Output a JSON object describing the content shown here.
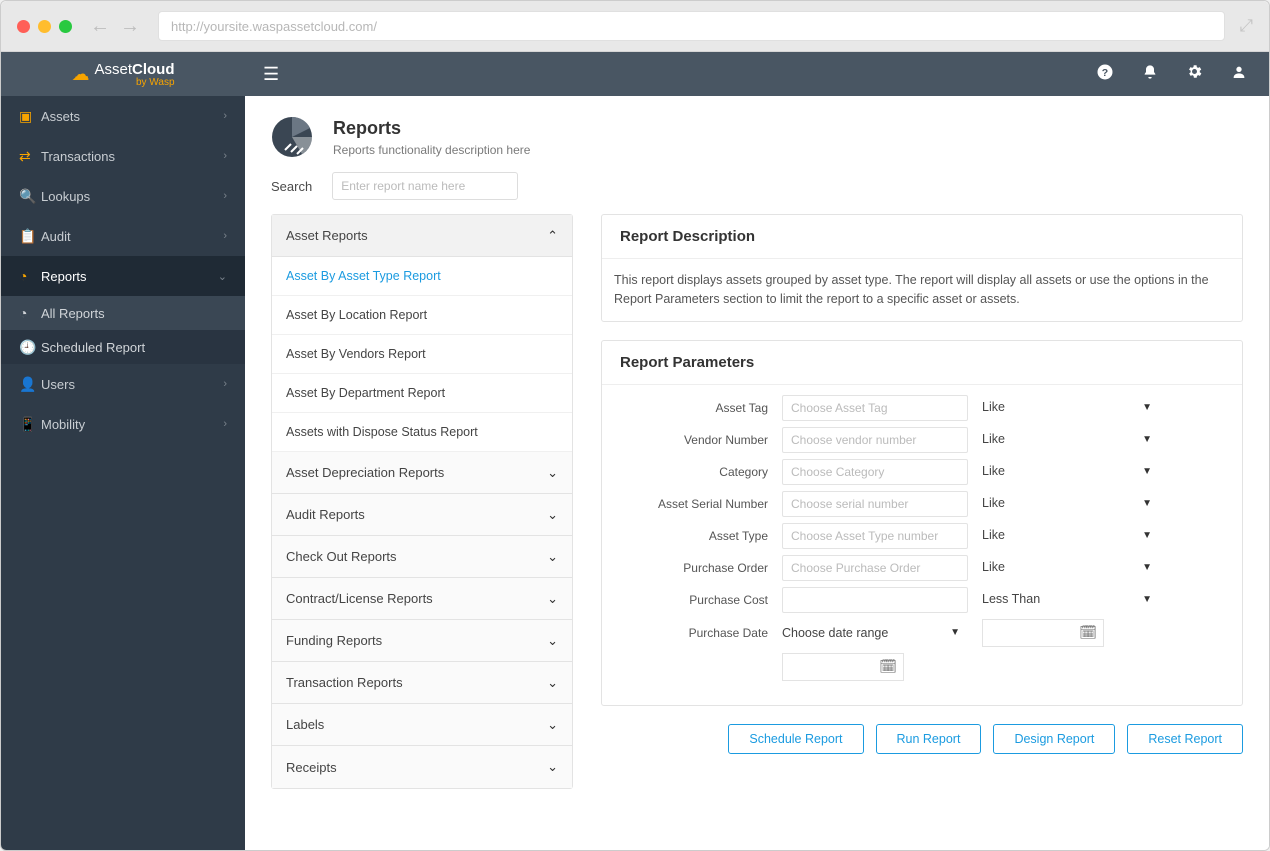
{
  "browser": {
    "url": "http://yoursite.waspassetcloud.com/"
  },
  "brand": {
    "name": "AssetCloud",
    "by": "by Wasp"
  },
  "sidebar": {
    "items": [
      {
        "label": "Assets",
        "icon": "box-icon"
      },
      {
        "label": "Transactions",
        "icon": "transactions-icon"
      },
      {
        "label": "Lookups",
        "icon": "search-icon"
      },
      {
        "label": "Audit",
        "icon": "clipboard-icon"
      },
      {
        "label": "Reports",
        "icon": "pie-icon",
        "active": true
      },
      {
        "label": "Users",
        "icon": "user-icon"
      },
      {
        "label": "Mobility",
        "icon": "tablet-icon"
      }
    ],
    "reports_sub": [
      {
        "label": "All Reports"
      },
      {
        "label": "Scheduled Report"
      }
    ]
  },
  "page": {
    "title": "Reports",
    "subtitle": "Reports functionality description here",
    "search_label": "Search",
    "search_placeholder": "Enter report name here"
  },
  "accordion": {
    "open": {
      "title": "Asset Reports",
      "items": [
        "Asset By Asset Type Report",
        "Asset By Location Report",
        "Asset By Vendors Report",
        "Asset By Department Report",
        "Assets with Dispose Status Report"
      ]
    },
    "closed": [
      "Asset Depreciation Reports",
      "Audit Reports",
      "Check Out Reports",
      "Contract/License Reports",
      "Funding Reports",
      "Transaction Reports",
      "Labels",
      "Receipts"
    ]
  },
  "description": {
    "title": "Report Description",
    "text": "This report displays assets grouped by asset type. The report will display all assets or use the options in the Report Parameters section to limit the report to a specific asset or assets."
  },
  "parameters": {
    "title": "Report Parameters",
    "rows": [
      {
        "label": "Asset Tag",
        "placeholder": "Choose Asset Tag",
        "op": "Like"
      },
      {
        "label": "Vendor Number",
        "placeholder": "Choose vendor number",
        "op": "Like"
      },
      {
        "label": "Category",
        "placeholder": "Choose Category",
        "op": "Like"
      },
      {
        "label": "Asset Serial Number",
        "placeholder": "Choose serial number",
        "op": "Like"
      },
      {
        "label": "Asset Type",
        "placeholder": "Choose Asset Type number",
        "op": "Like"
      },
      {
        "label": "Purchase Order",
        "placeholder": "Choose Purchase Order",
        "op": "Like"
      },
      {
        "label": "Purchase Cost",
        "placeholder": "",
        "op": "Less Than"
      }
    ],
    "date_row": {
      "label": "Purchase Date",
      "placeholder": "Choose date range"
    }
  },
  "actions": {
    "schedule": "Schedule Report",
    "run": "Run Report",
    "design": "Design Report",
    "reset": "Reset Report"
  }
}
